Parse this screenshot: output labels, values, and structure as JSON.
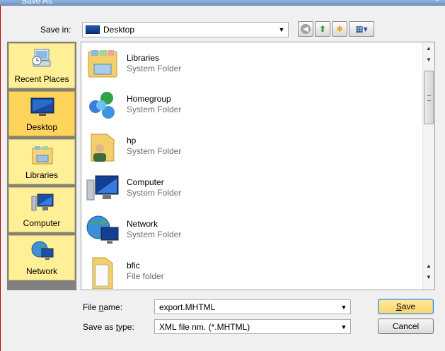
{
  "window": {
    "title": "Save As",
    "close_glyph": "×"
  },
  "toolbar": {
    "savein_label": "Save in:",
    "location_value": "Desktop",
    "location_icon": "desktop-icon",
    "back_glyph": "◀",
    "up_glyph": "⬆",
    "newfolder_glyph": "✱",
    "views_glyph": "▦▾"
  },
  "places": [
    {
      "label": "Recent Places",
      "icon": "recent-places-icon",
      "selected": false
    },
    {
      "label": "Desktop",
      "icon": "desktop-icon",
      "selected": true
    },
    {
      "label": "Libraries",
      "icon": "libraries-icon",
      "selected": false
    },
    {
      "label": "Computer",
      "icon": "computer-icon",
      "selected": false
    },
    {
      "label": "Network",
      "icon": "network-icon",
      "selected": false
    }
  ],
  "files": [
    {
      "name": "Libraries",
      "type": "System Folder",
      "icon": "libraries-folder-icon"
    },
    {
      "name": "Homegroup",
      "type": "System Folder",
      "icon": "homegroup-icon"
    },
    {
      "name": "hp",
      "type": "System Folder",
      "icon": "user-folder-icon"
    },
    {
      "name": "Computer",
      "type": "System Folder",
      "icon": "computer-icon"
    },
    {
      "name": "Network",
      "type": "System Folder",
      "icon": "network-icon"
    },
    {
      "name": "bfic",
      "type": "File folder",
      "icon": "folder-icon"
    }
  ],
  "bottom": {
    "filename_label_pre": "File ",
    "filename_label_u": "n",
    "filename_label_post": "ame:",
    "filename_value": "export.MHTML",
    "type_label_pre": "Save as ",
    "type_label_u": "t",
    "type_label_post": "ype:",
    "type_value": "XML file nm. (*.MHTML)",
    "save_u": "S",
    "save_rest": "ave",
    "cancel": "Cancel"
  },
  "colors": {
    "place_bg": "#ffef97",
    "place_selected": "#ffd45c",
    "muted_text": "#6d6d6d"
  }
}
